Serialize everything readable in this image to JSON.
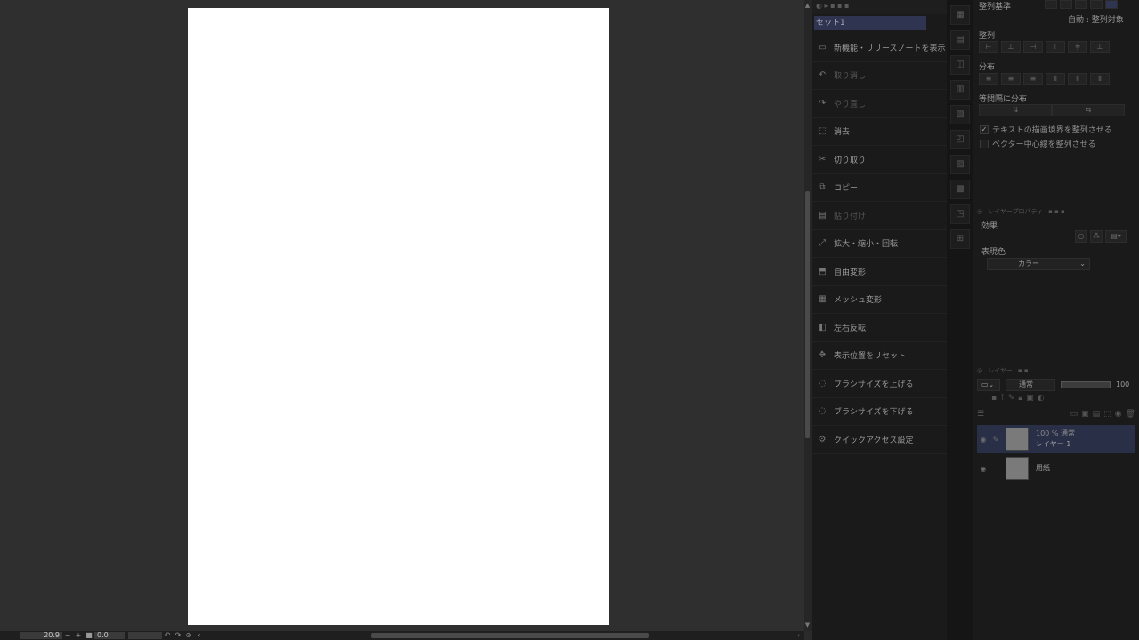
{
  "canvas": {
    "zoom": "20.9",
    "rotation": "0.0"
  },
  "quick_access": {
    "set_name": "セット1",
    "items": [
      {
        "label": "新機能・リリースノートを表示",
        "icon": "news-icon",
        "enabled": true
      },
      {
        "label": "取り消し",
        "icon": "undo-icon",
        "enabled": false
      },
      {
        "label": "やり直し",
        "icon": "redo-icon",
        "enabled": false
      },
      {
        "label": "消去",
        "icon": "clear-icon",
        "enabled": true
      },
      {
        "label": "切り取り",
        "icon": "scissors-icon",
        "enabled": true
      },
      {
        "label": "コピー",
        "icon": "copy-icon",
        "enabled": true
      },
      {
        "label": "貼り付け",
        "icon": "paste-icon",
        "enabled": false
      },
      {
        "label": "拡大・縮小・回転",
        "icon": "scale-icon",
        "enabled": true
      },
      {
        "label": "自由変形",
        "icon": "free-transform-icon",
        "enabled": true
      },
      {
        "label": "メッシュ変形",
        "icon": "mesh-icon",
        "enabled": true
      },
      {
        "label": "左右反転",
        "icon": "flip-icon",
        "enabled": true
      },
      {
        "label": "表示位置をリセット",
        "icon": "reset-view-icon",
        "enabled": true
      },
      {
        "label": "ブラシサイズを上げる",
        "icon": "brush-up-icon",
        "enabled": true
      },
      {
        "label": "ブラシサイズを下げる",
        "icon": "brush-down-icon",
        "enabled": true
      },
      {
        "label": "クイックアクセス設定",
        "icon": "settings-icon",
        "enabled": true
      }
    ]
  },
  "align_panel": {
    "basis_label": "整列基準",
    "basis_value": "自動 : 整列対象",
    "align_label": "整列",
    "distribute_label": "分布",
    "equal_spacing_label": "等間隔に分布",
    "check_text_bounds": "テキストの描画境界を整列させる",
    "check_text_bounds_checked": true,
    "check_vector_center": "ベクター中心線を整列させる",
    "check_vector_center_checked": false
  },
  "layer_property": {
    "tab_label": "レイヤープロパティ",
    "effect_label": "効果",
    "color_label": "表現色",
    "color_value": "カラー"
  },
  "layers": {
    "tab_label": "レイヤー",
    "blend_mode": "通常",
    "opacity": "100",
    "items": [
      {
        "line1": "100 % 通常",
        "name": "レイヤー 1",
        "selected": true
      },
      {
        "line1": "",
        "name": "用紙",
        "selected": false
      }
    ]
  },
  "colors": {
    "paper": "#ffffff",
    "canvas_bg": "#2f2f2f",
    "panel_bg": "#1a1a1a",
    "selection": "#2a2f48"
  }
}
